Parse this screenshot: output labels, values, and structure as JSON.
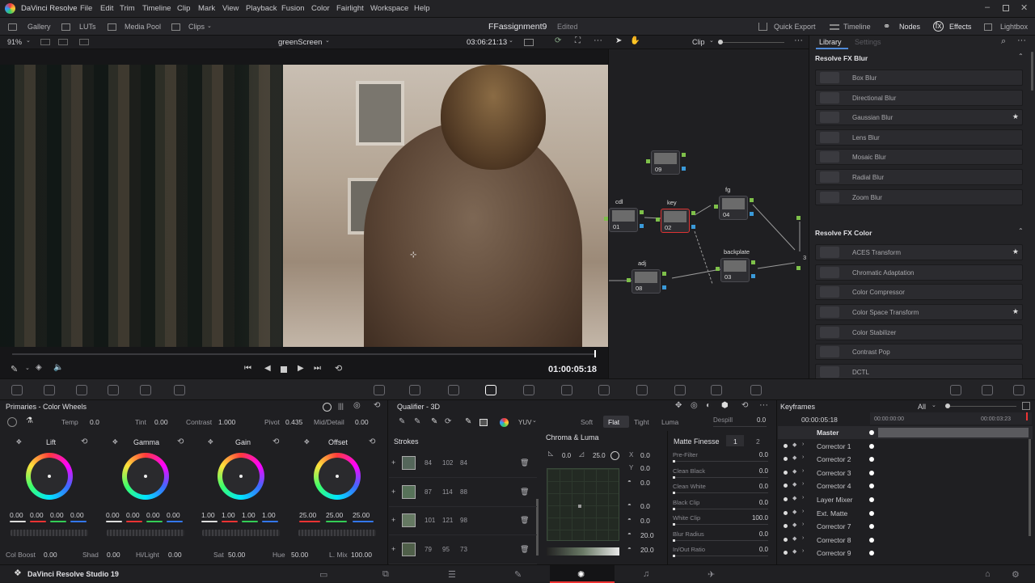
{
  "app": {
    "name": "DaVinci Resolve",
    "project": "FFassignment9",
    "status": "Edited",
    "footer": "DaVinci Resolve Studio 19"
  },
  "menu": [
    "File",
    "Edit",
    "Trim",
    "Timeline",
    "Clip",
    "Mark",
    "View",
    "Playback",
    "Fusion",
    "Color",
    "Fairlight",
    "Workspace",
    "Help"
  ],
  "toolbar": {
    "gallery": "Gallery",
    "luts": "LUTs",
    "media_pool": "Media Pool",
    "clips": "Clips",
    "quick_export": "Quick Export",
    "timeline": "Timeline",
    "nodes": "Nodes",
    "effects": "Effects",
    "lightbox": "Lightbox"
  },
  "viewer": {
    "zoom": "91%",
    "clip_name": "greenScreen",
    "timecode": "03:06:21:13",
    "playhead_tc": "01:00:05:18",
    "clip_mode": "Clip"
  },
  "library": {
    "tab_library": "Library",
    "tab_settings": "Settings",
    "sections": [
      {
        "title": "Resolve FX Blur",
        "items": [
          {
            "label": "Box Blur",
            "star": false
          },
          {
            "label": "Directional Blur",
            "star": false
          },
          {
            "label": "Gaussian Blur",
            "star": true
          },
          {
            "label": "Lens Blur",
            "star": false
          },
          {
            "label": "Mosaic Blur",
            "star": false
          },
          {
            "label": "Radial Blur",
            "star": false
          },
          {
            "label": "Zoom Blur",
            "star": false
          }
        ]
      },
      {
        "title": "Resolve FX Color",
        "items": [
          {
            "label": "ACES Transform",
            "star": true
          },
          {
            "label": "Chromatic Adaptation",
            "star": false
          },
          {
            "label": "Color Compressor",
            "star": false
          },
          {
            "label": "Color Space Transform",
            "star": true
          },
          {
            "label": "Color Stabilizer",
            "star": false
          },
          {
            "label": "Contrast Pop",
            "star": false
          },
          {
            "label": "DCTL",
            "star": false
          }
        ]
      }
    ]
  },
  "nodes": [
    {
      "num": "09",
      "label": ""
    },
    {
      "num": "01",
      "label": "cdl"
    },
    {
      "num": "02",
      "label": "key"
    },
    {
      "num": "04",
      "label": "fg"
    },
    {
      "num": "08",
      "label": "adj"
    },
    {
      "num": "03",
      "label": "backplate"
    }
  ],
  "node_partial_label": "3",
  "primaries": {
    "title": "Primaries - Color Wheels",
    "temp_label": "Temp",
    "temp": "0.0",
    "tint_label": "Tint",
    "tint": "0.00",
    "contrast_label": "Contrast",
    "contrast": "1.000",
    "pivot_label": "Pivot",
    "pivot": "0.435",
    "middetail_label": "Mid/Detail",
    "middetail": "0.00",
    "wheels": [
      {
        "name": "Lift",
        "vals": [
          "0.00",
          "0.00",
          "0.00",
          "0.00"
        ]
      },
      {
        "name": "Gamma",
        "vals": [
          "0.00",
          "0.00",
          "0.00",
          "0.00"
        ]
      },
      {
        "name": "Gain",
        "vals": [
          "1.00",
          "1.00",
          "1.00",
          "1.00"
        ]
      },
      {
        "name": "Offset",
        "vals": [
          "25.00",
          "25.00",
          "25.00"
        ]
      }
    ],
    "colboost_label": "Col Boost",
    "colboost": "0.00",
    "shad_label": "Shad",
    "shad": "0.00",
    "hilight_label": "Hi/Light",
    "hilight": "0.00",
    "sat_label": "Sat",
    "sat": "50.00",
    "hue_label": "Hue",
    "hue": "50.00",
    "lmix_label": "L. Mix",
    "lmix": "100.00"
  },
  "qualifier": {
    "title": "Qualifier - 3D",
    "colorspace": "YUV",
    "modes": [
      "Soft",
      "Flat",
      "Tight",
      "Luma"
    ],
    "active_mode": "Flat",
    "despill_label": "Despill",
    "despill": "0.0",
    "strokes_title": "Strokes",
    "strokes": [
      {
        "v": [
          "84",
          "102",
          "84"
        ],
        "color": "#54665a"
      },
      {
        "v": [
          "87",
          "114",
          "88"
        ],
        "color": "#577259"
      },
      {
        "v": [
          "101",
          "121",
          "98"
        ],
        "color": "#657962"
      },
      {
        "v": [
          "79",
          "95",
          "73"
        ],
        "color": "#4f5f49"
      }
    ],
    "chroma_title": "Chroma & Luma",
    "chroma_a": "0.0",
    "chroma_b": "25.0",
    "xyz": [
      {
        "l": "X",
        "v": "0.0"
      },
      {
        "l": "Y",
        "v": "0.0"
      },
      {
        "l": "",
        "v": "0.0"
      },
      {
        "l": "",
        "v": "0.0"
      },
      {
        "l": "",
        "v": "0.0"
      },
      {
        "l": "",
        "v": "20.0"
      },
      {
        "l": "",
        "v": "20.0"
      }
    ],
    "matte_title": "Matte Finesse",
    "matte_tabs": [
      "1",
      "2"
    ],
    "matte": [
      {
        "l": "Pre-Filter",
        "v": "0.0"
      },
      {
        "l": "Clean Black",
        "v": "0.0"
      },
      {
        "l": "Clean White",
        "v": "0.0"
      },
      {
        "l": "Black Clip",
        "v": "0.0"
      },
      {
        "l": "White Clip",
        "v": "100.0"
      },
      {
        "l": "Blur Radius",
        "v": "0.0"
      },
      {
        "l": "In/Out Ratio",
        "v": "0.0"
      }
    ]
  },
  "keyframes": {
    "title": "Keyframes",
    "filter": "All",
    "tc": "00:00:05:18",
    "ruler_start": "00:00:00:00",
    "ruler_end": "00:00:03:23",
    "rows": [
      "Master",
      "Corrector 1",
      "Corrector 2",
      "Corrector 3",
      "Corrector 4",
      "Layer Mixer",
      "Ext. Matte",
      "Corrector 7",
      "Corrector 8",
      "Corrector 9"
    ]
  }
}
